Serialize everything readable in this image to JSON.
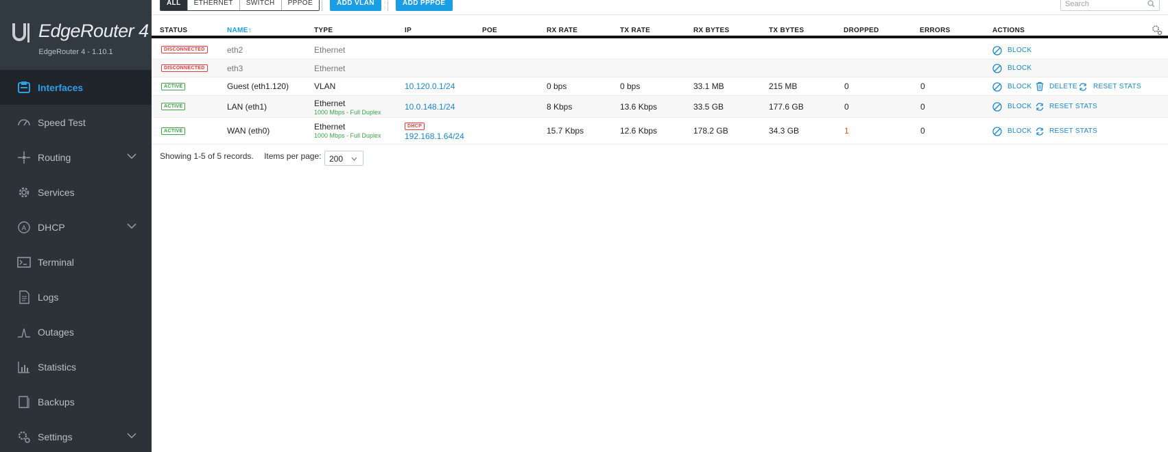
{
  "brand": {
    "title": "EdgeRouter 4",
    "version": "EdgeRouter 4 - 1.10.1"
  },
  "sidebar": {
    "items": [
      {
        "label": "Interfaces",
        "icon": "interfaces-icon",
        "active": true
      },
      {
        "label": "Speed Test",
        "icon": "speedometer-icon"
      },
      {
        "label": "Routing",
        "icon": "routing-icon",
        "expandable": true
      },
      {
        "label": "Services",
        "icon": "gear-icon"
      },
      {
        "label": "DHCP",
        "icon": "dhcp-icon",
        "expandable": true
      },
      {
        "label": "Terminal",
        "icon": "terminal-icon"
      },
      {
        "label": "Logs",
        "icon": "document-icon"
      },
      {
        "label": "Outages",
        "icon": "outages-icon"
      },
      {
        "label": "Statistics",
        "icon": "bar-chart-icon"
      },
      {
        "label": "Backups",
        "icon": "backup-icon"
      },
      {
        "label": "Settings",
        "icon": "settings-icon",
        "expandable": true
      }
    ]
  },
  "toolbar": {
    "filters": [
      "ALL",
      "ETHERNET",
      "SWITCH",
      "PPPOE"
    ],
    "add_vlan": "ADD VLAN",
    "add_pppoe": "ADD PPPOE",
    "search_placeholder": "Search"
  },
  "table": {
    "columns": [
      "STATUS",
      "NAME",
      "TYPE",
      "IP",
      "POE",
      "RX RATE",
      "TX RATE",
      "RX BYTES",
      "TX BYTES",
      "DROPPED",
      "ERRORS",
      "ACTIONS"
    ],
    "sort_indicator": "↑",
    "rows": [
      {
        "status": "DISCONNECTED",
        "name": "eth2",
        "type": "Ethernet",
        "type_sub": "",
        "ip_tag": "",
        "ip": "",
        "rx_rate": "",
        "tx_rate": "",
        "rx_bytes": "",
        "tx_bytes": "",
        "dropped": "",
        "errors": "",
        "actions": [
          "BLOCK"
        ]
      },
      {
        "status": "DISCONNECTED",
        "name": "eth3",
        "type": "Ethernet",
        "type_sub": "",
        "ip_tag": "",
        "ip": "",
        "rx_rate": "",
        "tx_rate": "",
        "rx_bytes": "",
        "tx_bytes": "",
        "dropped": "",
        "errors": "",
        "actions": [
          "BLOCK"
        ]
      },
      {
        "status": "ACTIVE",
        "name": "Guest (eth1.120)",
        "type": "VLAN",
        "type_sub": "",
        "ip_tag": "",
        "ip": "10.120.0.1/24",
        "rx_rate": "0 bps",
        "tx_rate": "0 bps",
        "rx_bytes": "33.1 MB",
        "tx_bytes": "215 MB",
        "dropped": "0",
        "errors": "0",
        "actions": [
          "BLOCK",
          "DELETE",
          "RESET STATS"
        ]
      },
      {
        "status": "ACTIVE",
        "name": "LAN (eth1)",
        "type": "Ethernet",
        "type_sub": "1000 Mbps - Full Duplex",
        "ip_tag": "",
        "ip": "10.0.148.1/24",
        "rx_rate": "8 Kbps",
        "tx_rate": "13.6 Kbps",
        "rx_bytes": "33.5 GB",
        "tx_bytes": "177.6 GB",
        "dropped": "0",
        "errors": "0",
        "actions": [
          "BLOCK",
          "RESET STATS"
        ]
      },
      {
        "status": "ACTIVE",
        "name": "WAN (eth0)",
        "type": "Ethernet",
        "type_sub": "1000 Mbps - Full Duplex",
        "ip_tag": "DHCP",
        "ip": "192.168.1.64/24",
        "rx_rate": "15.7 Kbps",
        "tx_rate": "12.6 Kbps",
        "rx_bytes": "178.2 GB",
        "tx_bytes": "34.3 GB",
        "dropped": "1",
        "errors": "0",
        "actions": [
          "BLOCK",
          "RESET STATS"
        ]
      }
    ]
  },
  "footer": {
    "records_text": "Showing 1-5 of 5 records.",
    "per_page_label": "Items per page:",
    "per_page_value": "200"
  },
  "colors": {
    "sidebar_bg": "#2b3238",
    "accent": "#1a9ee6",
    "active_green": "#43a047",
    "error_red": "#e23b3b"
  }
}
